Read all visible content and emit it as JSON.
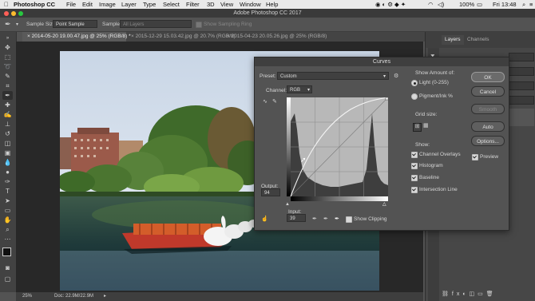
{
  "menubar": {
    "apple": "",
    "app": "Photoshop CC",
    "items": [
      "File",
      "Edit",
      "Image",
      "Layer",
      "Type",
      "Select",
      "Filter",
      "3D",
      "View",
      "Window",
      "Help"
    ],
    "battery": "100%",
    "clock": "Fri 13:48"
  },
  "window": {
    "title": "Adobe Photoshop CC 2017"
  },
  "options": {
    "sample_size_label": "Sample Size:",
    "sample_size_value": "Point Sample",
    "sample_label": "Sample:",
    "sample_value": "All Layers",
    "sampling_ring_label": "Show Sampling Ring"
  },
  "tabs": [
    {
      "label": "2014-05-20 19.00.47.jpg @ 25% (RGB/8) *"
    },
    {
      "label": "2015-12-29 15.03.42.jpg @ 20.7% (RGB/8)"
    },
    {
      "label": "2015-04-23 20.05.26.jpg @ 25% (RGB/8)"
    }
  ],
  "status": {
    "zoom": "25%",
    "doc": "Doc: 22.9M/22.9M"
  },
  "panels": {
    "layers_tab": "Layers",
    "channels_tab": "Channels"
  },
  "curves": {
    "title": "Curves",
    "preset_label": "Preset:",
    "preset_value": "Custom",
    "channel_label": "Channel:",
    "channel_value": "RGB",
    "output_label": "Output:",
    "output_value": "94",
    "input_label": "Input:",
    "input_value": "39",
    "show_clipping": "Show Clipping",
    "show_amount_label": "Show Amount of:",
    "light_label": "Light  (0-255)",
    "pigment_label": "Pigment/Ink %",
    "grid_size_label": "Grid size:",
    "show_label": "Show:",
    "channel_overlays": "Channel Overlays",
    "histogram": "Histogram",
    "baseline": "Baseline",
    "intersection_line": "Intersection Line",
    "ok": "OK",
    "cancel": "Cancel",
    "smooth": "Smooth",
    "auto": "Auto",
    "options": "Options...",
    "preview": "Preview"
  }
}
